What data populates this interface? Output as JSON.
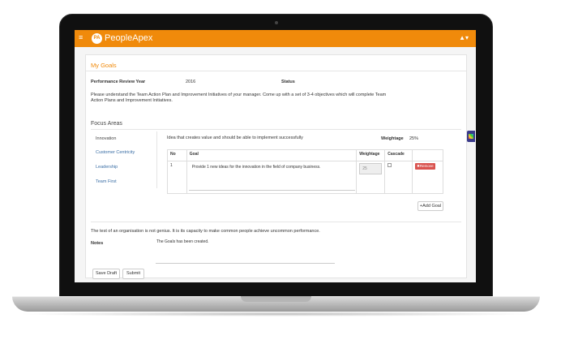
{
  "app": {
    "brand": "PeopleApex",
    "logo_text": "PA",
    "menu_icon": "≡",
    "user_icon": "▲▾"
  },
  "page": {
    "title": "My Goals",
    "review_year_label": "Performance Review Year",
    "review_year_value": "2016",
    "status_label": "Status",
    "intro_text_1": "Please understand the Team Action Plan and Improvement Initiatives of your manager. Come up with a set of 3-4 objectives which will complete Team",
    "intro_text_2": "Action Plans and Improvement Initiatives."
  },
  "focus": {
    "title": "Focus Areas",
    "areas": [
      "Innovation",
      "Customer Centricity",
      "Leadership",
      "Team First"
    ],
    "description": "Idea that creates value and should be able to implement successfully",
    "weightage_label": "Weightage",
    "weightage_value": "25%"
  },
  "table": {
    "headers": {
      "no": "No",
      "goal": "Goal",
      "weightage": "Weightage",
      "cascade": "Cascade"
    },
    "rows": [
      {
        "no": "1",
        "goal": "Provide 1 new ideas for the innovation in the field of company business.",
        "weightage": "25",
        "remove": "Remove"
      }
    ]
  },
  "actions": {
    "add_goal": "+Add Goal",
    "save_draft": "Save Draft",
    "submit": "Submit"
  },
  "footer": {
    "quote": "The test of an organisation is not genius. It is its capacity to make common people achieve uncommon performance.",
    "notes_label": "Notes",
    "notes_value": "The Goals has been created."
  },
  "colors": {
    "brand": "#f08a0b",
    "link": "#3a6ea5",
    "danger": "#d9534f"
  }
}
